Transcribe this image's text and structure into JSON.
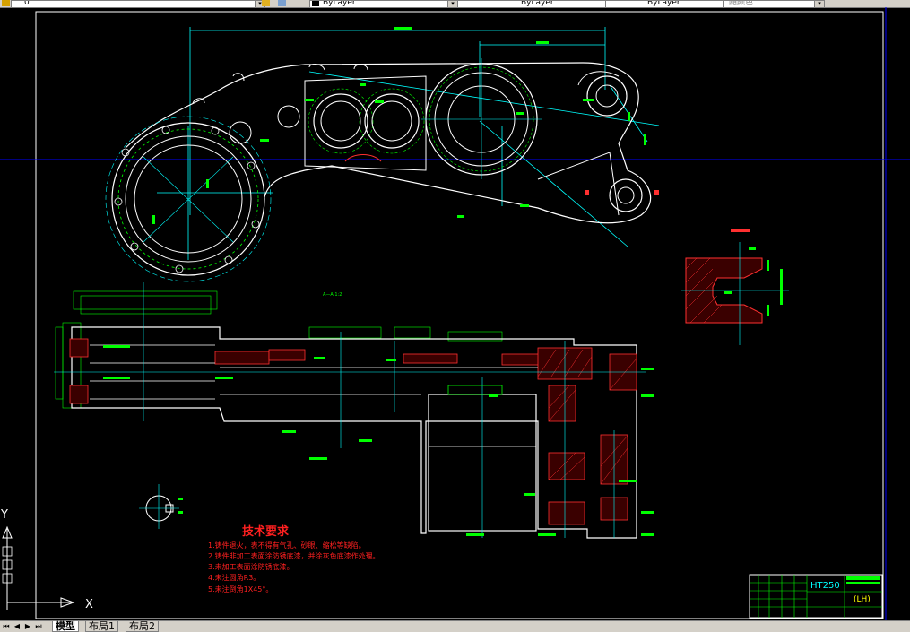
{
  "toolbar": {
    "layer_value": "0",
    "color_value": "ByLayer",
    "linetype_value": "ByLayer",
    "lineweight_value": "ByLayer",
    "plotstyle_value": "随颜色"
  },
  "drawing": {
    "tech_title": "技术要求",
    "tech_notes": [
      "1.铸件退火，表不得有气孔、砂眼、缩松等缺陷。",
      "2.铸件非加工表面涂防锈底漆，并涂灰色底漆作处理。",
      "3.未加工表面涂防锈底漆。",
      "4.未注圆角R3。",
      "5.未注倒角1X45°。"
    ],
    "section_label": "A—A 1:2",
    "material": "HT250",
    "title_block_code": "(LH)",
    "colors": {
      "background": "#000000",
      "outline": "#ffffff",
      "dimension": "#00ff00",
      "centerline": "#00ffff",
      "hatch": "#ff3030",
      "note_text": "#ff2020",
      "crosshair": "#0000ff"
    }
  },
  "ucs": {
    "x_label": "X",
    "y_label": "Y"
  },
  "layout_tabs": [
    "模型",
    "布局1",
    "布局2"
  ],
  "active_tab": "模型"
}
